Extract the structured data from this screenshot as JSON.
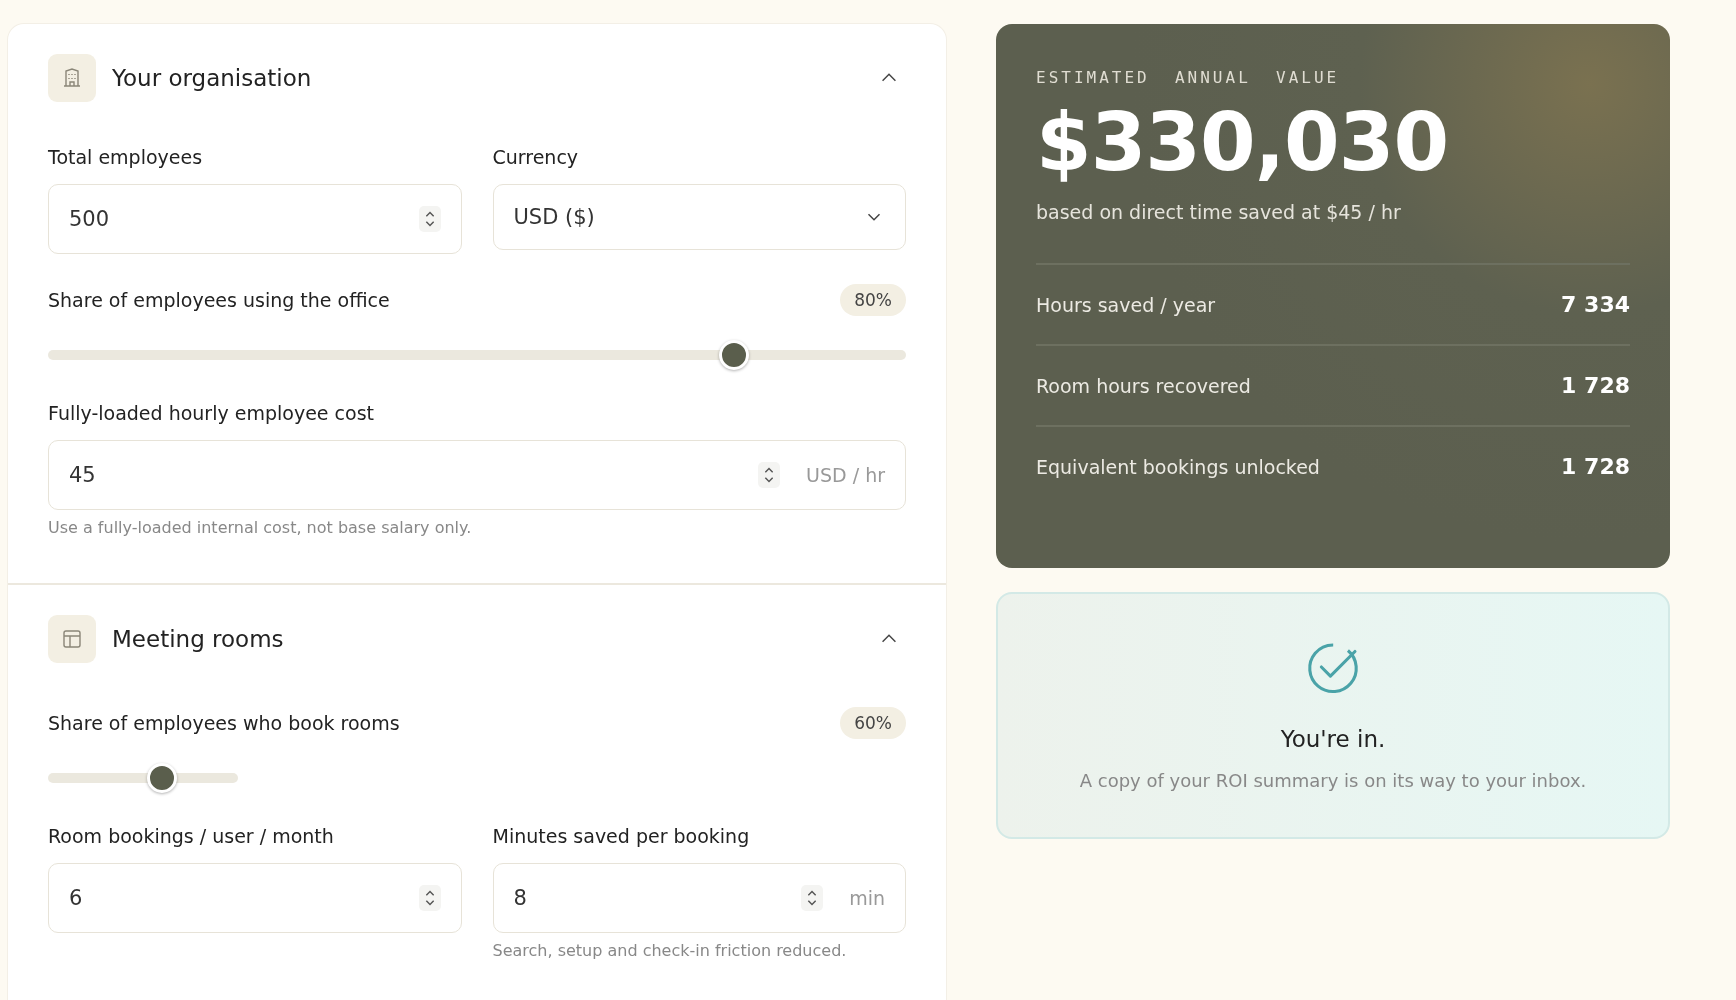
{
  "sections": [
    {
      "title": "Your organisation",
      "expanded": true,
      "rows": [
        [
          {
            "kind": "number",
            "label": "Total employees",
            "value": "500"
          },
          {
            "kind": "select",
            "label": "Currency",
            "value": "USD ($)"
          }
        ],
        [
          {
            "kind": "slider",
            "label": "Share of employees using the office",
            "badge": "80%",
            "level": 0.8
          }
        ],
        [
          {
            "kind": "number",
            "label": "Fully-loaded hourly employee cost",
            "value": "45",
            "unit": "USD / hr",
            "hint": "Use a fully-loaded internal cost, not base salary only."
          }
        ]
      ]
    },
    {
      "title": "Meeting rooms",
      "expanded": true,
      "rows": [
        [
          {
            "kind": "slider_compact",
            "label": "Share of employees who book rooms",
            "badge": "60%",
            "level": 0.6
          }
        ],
        [
          {
            "kind": "number",
            "label": "Room bookings / user / month",
            "value": "6"
          },
          {
            "kind": "number",
            "label": "Minutes saved per booking",
            "value": "8",
            "unit": "min",
            "hint": "Search, setup and check-in friction reduced."
          }
        ]
      ]
    }
  ],
  "summary": {
    "eyebrow": "ESTIMATED  ANNUAL  VALUE",
    "total": "$330,030",
    "basis": "based on direct time saved at $45 / hr",
    "metrics": [
      {
        "label": "Hours saved / year",
        "value": "7 334"
      },
      {
        "label": "Room hours recovered",
        "value": "1 728"
      },
      {
        "label": "Equivalent bookings unlocked",
        "value": "1 728"
      }
    ]
  },
  "confirmation": {
    "title": "You're in.",
    "message": "A copy of your ROI summary is on its way to your inbox."
  }
}
